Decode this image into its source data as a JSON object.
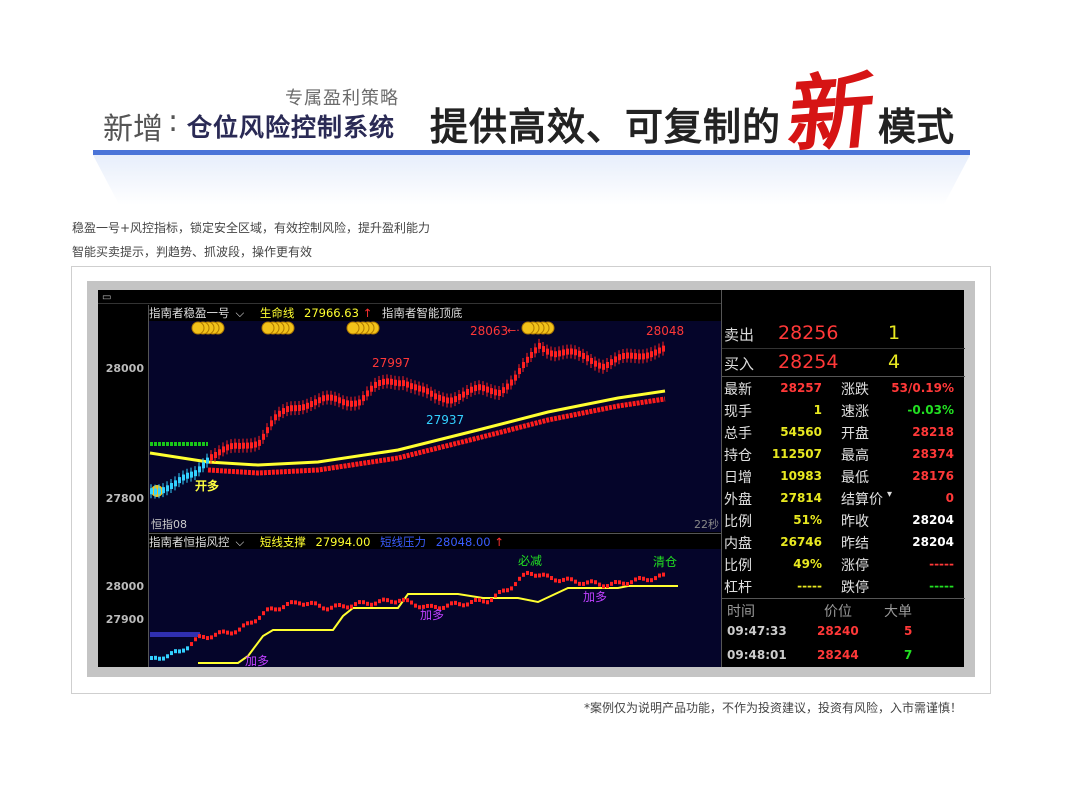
{
  "banner": {
    "subtitle": "专属盈利策略",
    "prefix": "新增",
    "colon": ":",
    "system": "仓位风险控制系统",
    "main": "提供高效、可复制的",
    "emphasis": "新",
    "suffix": "模式"
  },
  "description": {
    "line1": "稳盈一号+风控指标，锁定安全区域，有效控制风险，提升盈利能力",
    "line2": "智能买卖提示，判趋势、抓波段，操作更有效"
  },
  "chart": {
    "window_icon": "window-icon",
    "header1": {
      "indicator": "指南者稳盈一号",
      "lifeline_label": "生命线",
      "lifeline_value": "27966.63",
      "arrow": "↑",
      "indicator2": "指南者智能顶底"
    },
    "header2": {
      "indicator": "指南者恒指风控",
      "support_label": "短线支撑",
      "support_value": "27994.00",
      "pressure_label": "短线压力",
      "pressure_value": "28048.00",
      "arrow": "↑"
    },
    "upper_y_ticks": [
      "28000",
      "27800"
    ],
    "lower_y_ticks": [
      "28000",
      "27900"
    ],
    "symbol": "恒指08",
    "seconds": "22秒",
    "annotations": {
      "open_long": "开多",
      "peak1": "27997",
      "trough": "27937",
      "peak2": "28063",
      "peak3": "28048",
      "must_reduce": "必减",
      "clear": "清仓",
      "add_long": "加多"
    },
    "colors": {
      "up_candle": "#ff2020",
      "down_candle": "#33d0ff",
      "lifeline": "#ffff30",
      "support": "#ffff30",
      "background": "#05052a"
    }
  },
  "quote": {
    "sell_label": "卖出",
    "sell_price": "28256",
    "sell_vol": "1",
    "buy_label": "买入",
    "buy_price": "28254",
    "buy_vol": "4",
    "rows": [
      {
        "l1": "最新",
        "v1": "28257",
        "c1": "#ff3838",
        "l2": "涨跌",
        "v2": "53/0.19%",
        "c2": "#ff3838"
      },
      {
        "l1": "现手",
        "v1": "1",
        "c1": "#e8e820",
        "l2": "速涨",
        "v2": "-0.03%",
        "c2": "#22e022"
      },
      {
        "l1": "总手",
        "v1": "54560",
        "c1": "#e8e820",
        "l2": "开盘",
        "v2": "28218",
        "c2": "#ff3838"
      },
      {
        "l1": "持仓",
        "v1": "112507",
        "c1": "#e8e820",
        "l2": "最高",
        "v2": "28374",
        "c2": "#ff3838"
      },
      {
        "l1": "日增",
        "v1": "10983",
        "c1": "#e8e820",
        "l2": "最低",
        "v2": "28176",
        "c2": "#ff3838"
      },
      {
        "l1": "外盘",
        "v1": "27814",
        "c1": "#e8e820",
        "l2": "结算价",
        "v2": "0",
        "c2": "#ff3838"
      },
      {
        "l1": "比例",
        "v1": "51%",
        "c1": "#e8e820",
        "l2": "昨收",
        "v2": "28204",
        "c2": "#ffffff"
      },
      {
        "l1": "内盘",
        "v1": "26746",
        "c1": "#e8e820",
        "l2": "昨结",
        "v2": "28204",
        "c2": "#ffffff"
      },
      {
        "l1": "比例",
        "v1": "49%",
        "c1": "#e8e820",
        "l2": "涨停",
        "v2": "-----",
        "c2": "#ff3838"
      },
      {
        "l1": "杠杆",
        "v1": "-----",
        "c1": "#e8e820",
        "l2": "跌停",
        "v2": "-----",
        "c2": "#22e022"
      }
    ],
    "trades_header": {
      "time": "时间",
      "price": "价位",
      "size": "大单"
    },
    "trades": [
      {
        "time": "09:47:33",
        "price": "28240",
        "vol": "5",
        "vc": "#ff3838"
      },
      {
        "time": "09:48:01",
        "price": "28244",
        "vol": "7",
        "vc": "#22e022"
      }
    ]
  },
  "disclaimer": "*案例仅为说明产品功能，不作为投资建议，投资有风险，入市需谨慎！"
}
